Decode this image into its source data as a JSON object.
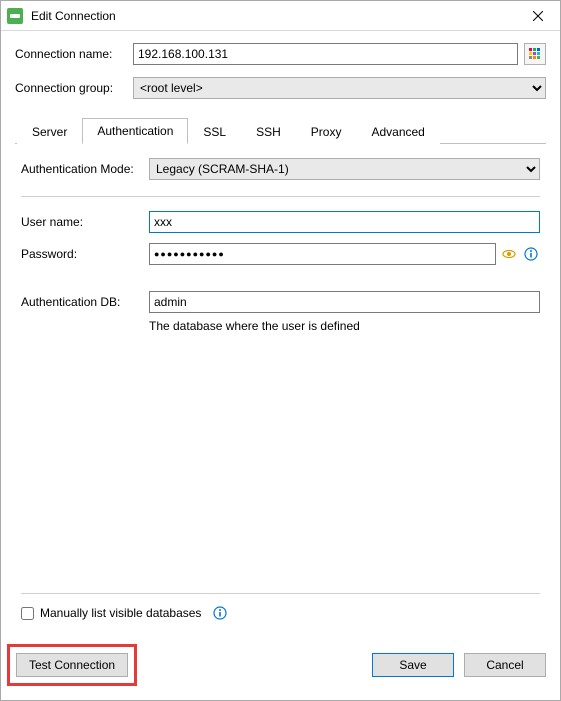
{
  "window": {
    "title": "Edit Connection"
  },
  "fields": {
    "connection_name_label": "Connection name:",
    "connection_name_value": "192.168.100.131",
    "connection_group_label": "Connection group:",
    "connection_group_value": "<root level>"
  },
  "tabs": {
    "server": "Server",
    "authentication": "Authentication",
    "ssl": "SSL",
    "ssh": "SSH",
    "proxy": "Proxy",
    "advanced": "Advanced"
  },
  "auth": {
    "mode_label": "Authentication Mode:",
    "mode_value": "Legacy (SCRAM-SHA-1)",
    "user_label": "User name:",
    "user_value": "xxx",
    "password_label": "Password:",
    "password_mask": "●●●●●●●●●●●",
    "db_label": "Authentication DB:",
    "db_value": "admin",
    "db_helper": "The database where the user is defined",
    "list_db_label": "Manually list visible databases",
    "list_db_checked": false
  },
  "buttons": {
    "test": "Test Connection",
    "save": "Save",
    "cancel": "Cancel"
  }
}
